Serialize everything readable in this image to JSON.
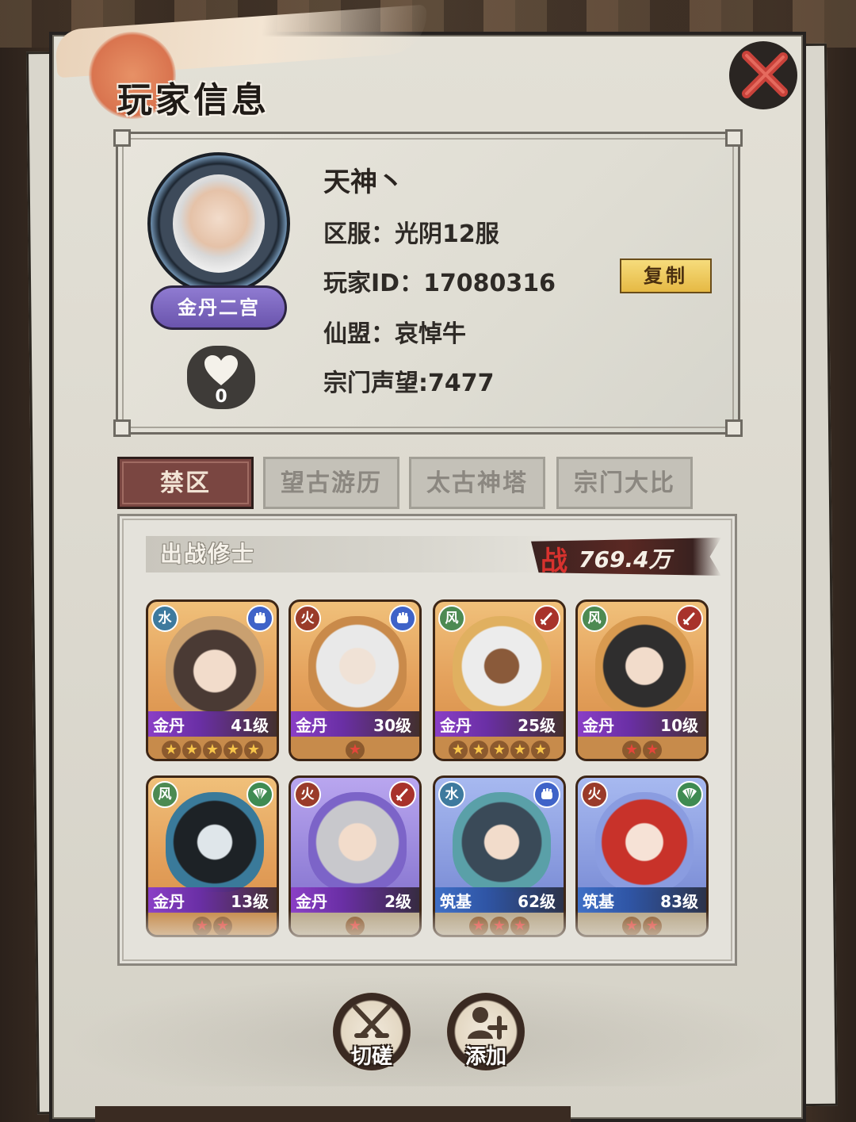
{
  "window": {
    "title": "玩家信息"
  },
  "profile": {
    "name": "天神丶",
    "server_line": "区服：光阴12服",
    "player_id_line": "玩家ID：17080316",
    "alliance_line": "仙盟：哀悼牛",
    "reputation_line": "宗门声望:7477",
    "copy_label": "复制",
    "rank": "金丹二宫",
    "likes": "0"
  },
  "tabs": [
    {
      "label": "禁区",
      "active": true
    },
    {
      "label": "望古游历",
      "active": false
    },
    {
      "label": "太古神塔",
      "active": false
    },
    {
      "label": "宗门大比",
      "active": false
    }
  ],
  "team": {
    "header": "出战修士",
    "power_char": "战",
    "power_value": "769.4万",
    "heroes": [
      {
        "element": "水",
        "class_icon": "fist-icon",
        "realm": "金丹",
        "level": "41级",
        "stars": 5,
        "star_color": "gold",
        "frame": "orange"
      },
      {
        "element": "火",
        "class_icon": "fist-icon",
        "realm": "金丹",
        "level": "30级",
        "stars": 1,
        "star_color": "red",
        "frame": "orange"
      },
      {
        "element": "风",
        "class_icon": "sword-icon",
        "realm": "金丹",
        "level": "25级",
        "stars": 5,
        "star_color": "gold",
        "frame": "orange"
      },
      {
        "element": "风",
        "class_icon": "sword-icon",
        "realm": "金丹",
        "level": "10级",
        "stars": 2,
        "star_color": "red",
        "frame": "orange"
      },
      {
        "element": "风",
        "class_icon": "fan-icon",
        "realm": "金丹",
        "level": "13级",
        "stars": 2,
        "star_color": "red",
        "frame": "orange"
      },
      {
        "element": "火",
        "class_icon": "sword-icon",
        "realm": "金丹",
        "level": "2级",
        "stars": 1,
        "star_color": "red",
        "frame": "purple"
      },
      {
        "element": "水",
        "class_icon": "fist-icon",
        "realm": "筑基",
        "level": "62级",
        "stars": 3,
        "star_color": "red",
        "frame": "blue"
      },
      {
        "element": "火",
        "class_icon": "fan-icon",
        "realm": "筑基",
        "level": "83级",
        "stars": 2,
        "star_color": "red",
        "frame": "blue"
      }
    ]
  },
  "actions": {
    "spar_label": "切磋",
    "add_label": "添加"
  },
  "colors": {
    "tab_active": "#7a4641",
    "copy_button": "#f0cf63",
    "rank_badge": "#7a66c0",
    "power_red": "#d8322e"
  }
}
